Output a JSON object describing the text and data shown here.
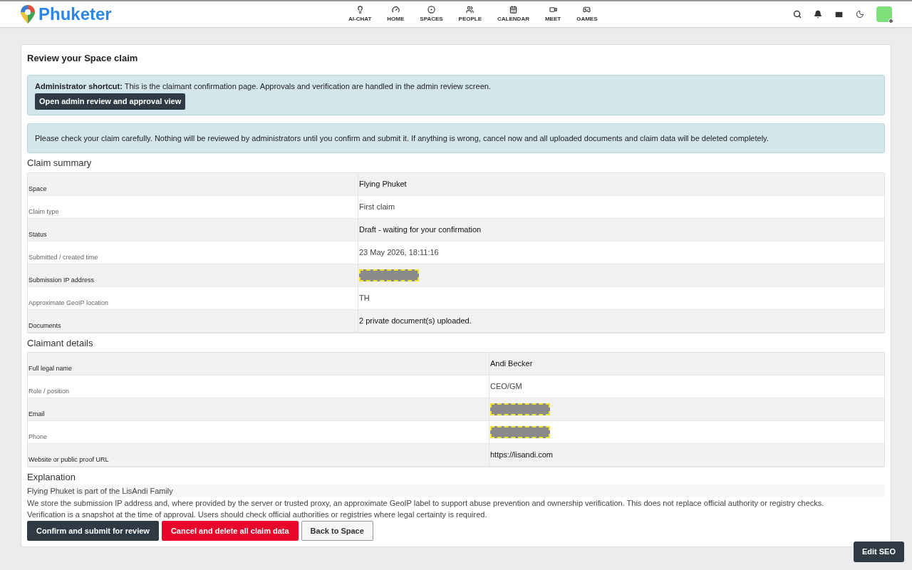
{
  "brand": "Phuketer",
  "nav": [
    {
      "label": "AI-CHAT"
    },
    {
      "label": "HOME"
    },
    {
      "label": "SPACES"
    },
    {
      "label": "PEOPLE"
    },
    {
      "label": "CALENDAR"
    },
    {
      "label": "MEET"
    },
    {
      "label": "GAMES"
    }
  ],
  "title": "Review your Space claim",
  "admin_notice": {
    "bold": "Administrator shortcut:",
    "text": "This is the claimant confirmation page. Approvals and verification are handled in the admin review screen.",
    "button": "Open admin review and approval view"
  },
  "info_notice": "Please check your claim carefully. Nothing will be reviewed by administrators until you confirm and submit it. If anything is wrong, cancel now and all uploaded documents and claim data will be deleted completely.",
  "sections": [
    {
      "heading": "Claim summary",
      "rows": [
        {
          "label": "Space",
          "value": "Flying Phuket",
          "redacted": false
        },
        {
          "label": "Claim type",
          "value": "First claim",
          "redacted": false
        },
        {
          "label": "Status",
          "value": "Draft - waiting for your confirmation",
          "redacted": false
        },
        {
          "label": "Submitted / created time",
          "value": "23 May 2026, 18:11:16",
          "redacted": false
        },
        {
          "label": "Submission IP address",
          "redacted": true
        },
        {
          "label": "Approximate GeoIP location",
          "value": "TH",
          "redacted": false
        },
        {
          "label": "Documents",
          "value": "2 private document(s) uploaded.",
          "redacted": false
        }
      ]
    },
    {
      "heading": "Claimant details",
      "rows": [
        {
          "label": "Full legal name",
          "value": "Andi Becker",
          "redacted": false
        },
        {
          "label": "Role / position",
          "value": "CEO/GM",
          "redacted": false
        },
        {
          "label": "Email",
          "redacted": true
        },
        {
          "label": "Phone",
          "redacted": true
        },
        {
          "label": "Website or public proof URL",
          "value": "https://lisandi.com",
          "redacted": false
        }
      ]
    }
  ],
  "explanation": {
    "heading": "Explanation",
    "text": "Flying Phuket is part of the LisAndi Family",
    "notes": [
      "We store the submission IP address and, where provided by the server or trusted proxy, an approximate GeoIP label to support abuse prevention and ownership verification. This does not replace official authority or registry checks.",
      "Verification is a snapshot at the time of approval. Users should check official authorities or registries where legal certainty is required."
    ]
  },
  "actions": [
    {
      "label": "Confirm and submit for review",
      "kind": "primary"
    },
    {
      "label": "Cancel and delete all claim data",
      "kind": "danger"
    },
    {
      "label": "Back to Space",
      "kind": "secondary"
    }
  ],
  "seo_button": "Edit SEO"
}
